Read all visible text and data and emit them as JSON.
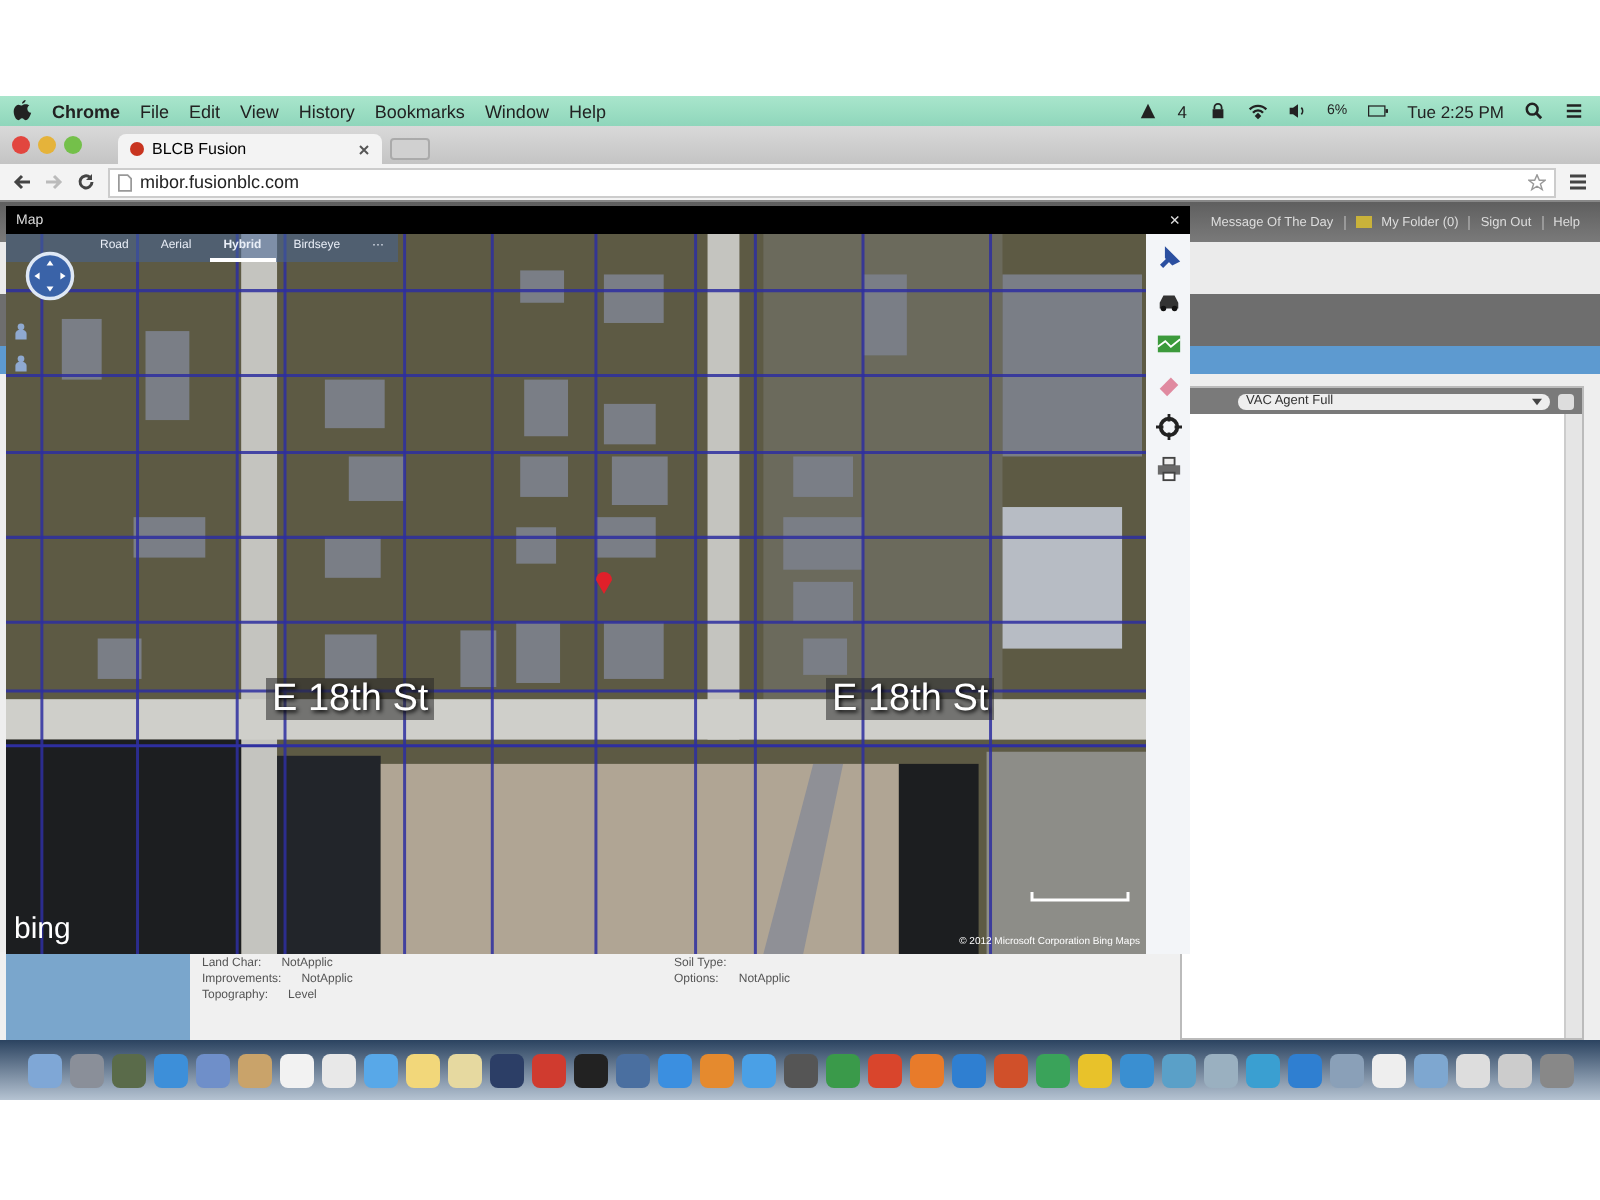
{
  "menubar": {
    "app": "Chrome",
    "menus": [
      "File",
      "Edit",
      "View",
      "History",
      "Bookmarks",
      "Window",
      "Help"
    ],
    "status": {
      "count": "4",
      "battery": "6%",
      "clock": "Tue 2:25 PM"
    }
  },
  "browser": {
    "tab": {
      "title": "BLCB Fusion"
    },
    "url": "mibor.fusionblc.com"
  },
  "page": {
    "header_links": [
      "Message Of The Day",
      "My Folder (0)",
      "Sign Out",
      "Help"
    ],
    "agent_select": {
      "value": "VAC Agent Full"
    },
    "details_left": [
      {
        "label": "Land Char:",
        "value": "NotApplic"
      },
      {
        "label": "Improvements:",
        "value": "NotApplic"
      },
      {
        "label": "Topography:",
        "value": "Level"
      }
    ],
    "details_right": [
      {
        "label": "Soil Type:"
      },
      {
        "label": "Options:",
        "value": "NotApplic"
      }
    ]
  },
  "map": {
    "title": "Map",
    "close": "×",
    "map_types": [
      {
        "label": "Road",
        "selected": false
      },
      {
        "label": "Aerial",
        "selected": false
      },
      {
        "label": "Hybrid",
        "selected": true
      },
      {
        "label": "Birdseye",
        "selected": false
      }
    ],
    "more": "···",
    "street_labels": [
      "E 18th St",
      "E 18th St"
    ],
    "logo": "bing",
    "copyright": "© 2012 Microsoft Corporation  Bing Maps"
  }
}
